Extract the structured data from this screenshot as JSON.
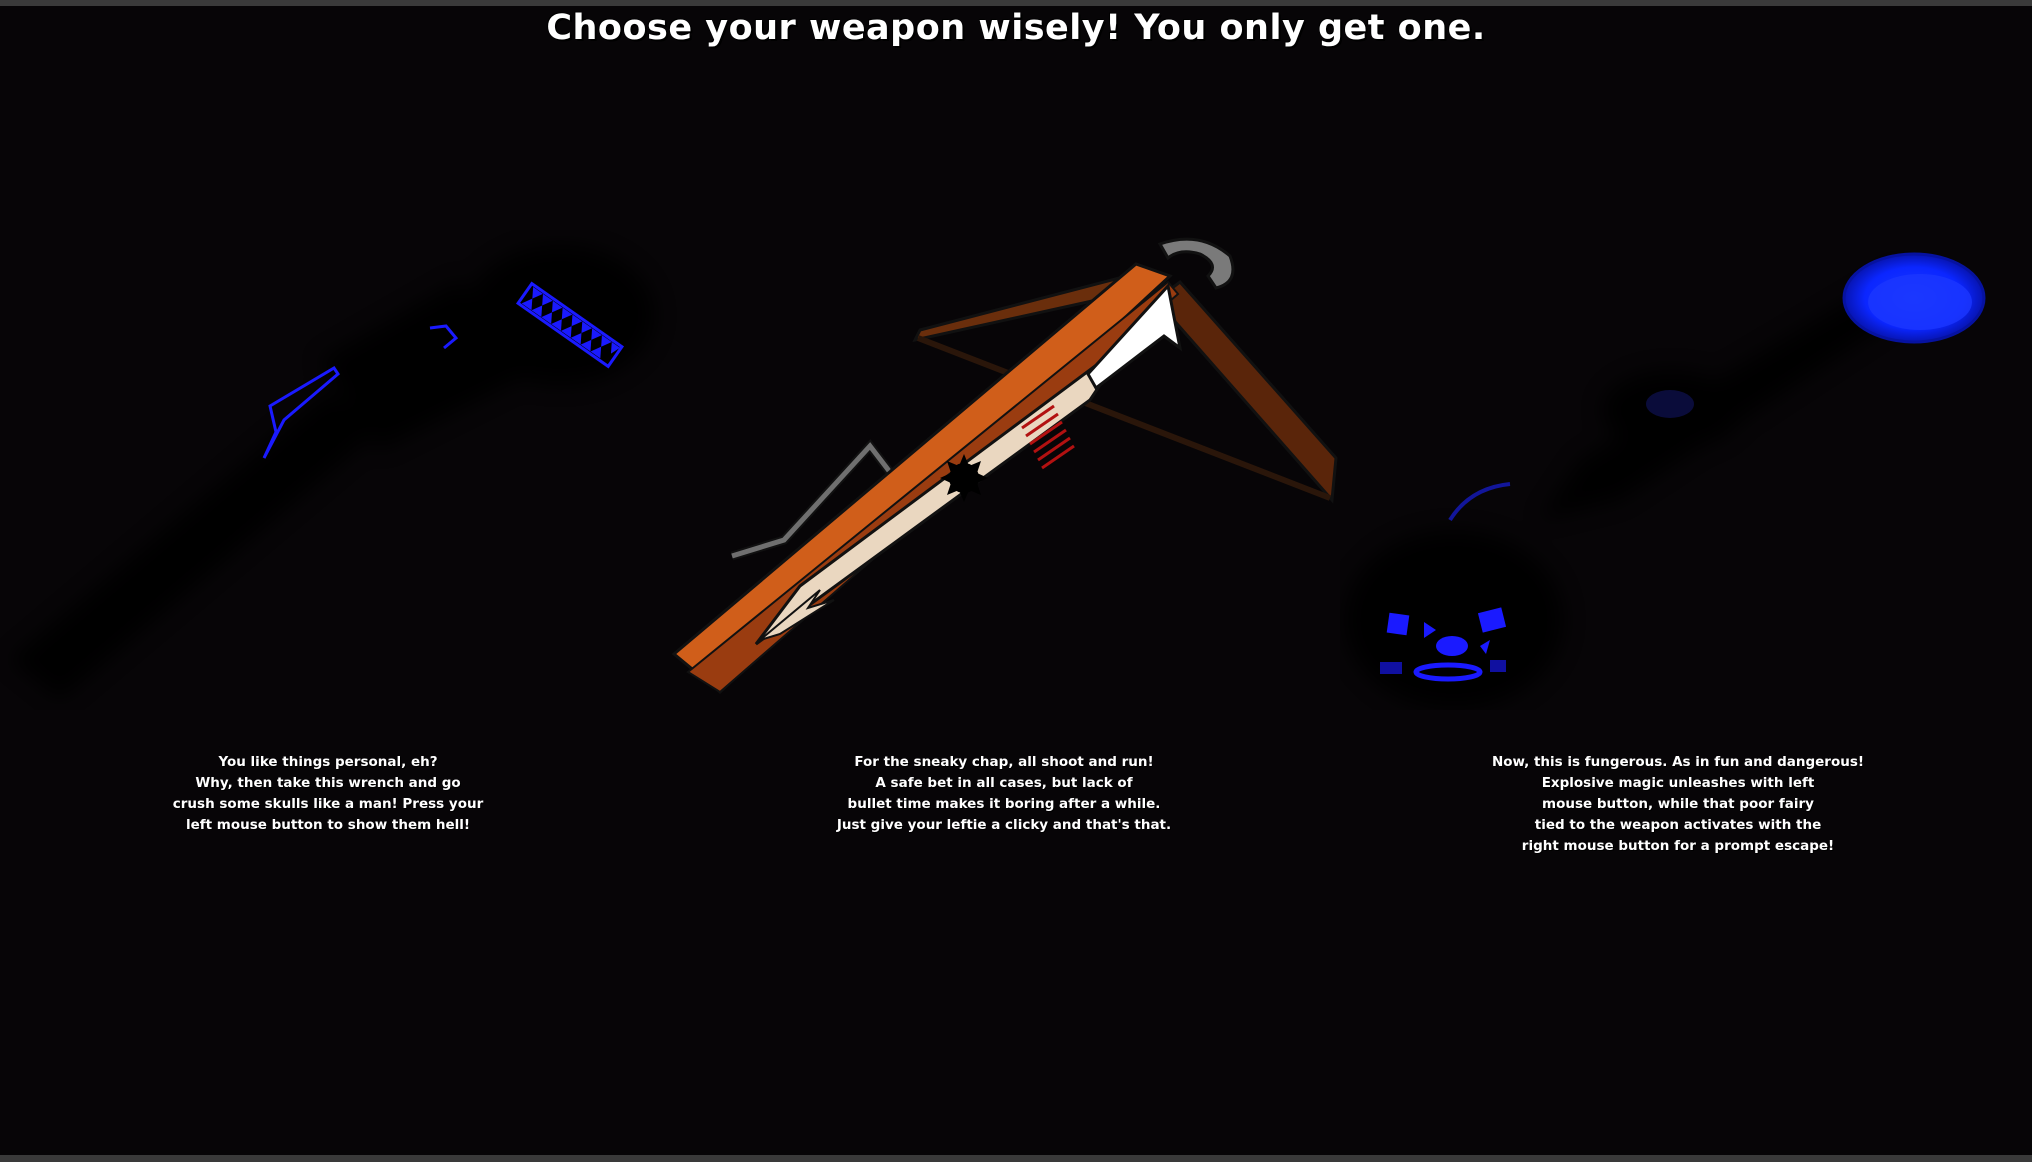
{
  "title": "Choose your weapon wisely! You only get one.",
  "weapons": [
    {
      "id": "wrench",
      "icon": "wrench-icon",
      "accent": "#1a1aff",
      "description_lines": [
        "You like things personal, eh?",
        "Why, then take this wrench and go",
        "crush some skulls like a man! Press your",
        "left mouse button to show them hell!"
      ]
    },
    {
      "id": "crossbow",
      "icon": "crossbow-icon",
      "accent": "#c4571a",
      "description_lines": [
        "For the sneaky chap, all shoot and run!",
        "A safe bet in all cases, but lack of",
        "bullet time makes it boring after a while.",
        "Just give your leftie a clicky and that's that."
      ]
    },
    {
      "id": "staff",
      "icon": "magic-staff-icon",
      "accent": "#0a2aff",
      "description_lines": [
        "Now, this is fungerous. As in fun and dangerous!",
        "Explosive magic unleashes with left",
        "mouse button, while that poor fairy",
        "tied to the weapon activates with the",
        "right mouse button for a prompt escape!"
      ]
    }
  ]
}
